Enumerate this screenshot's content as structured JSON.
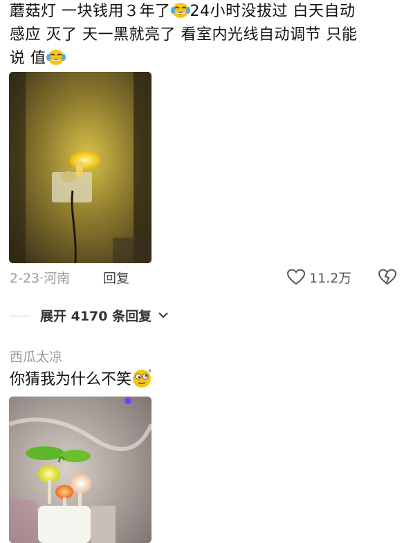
{
  "comment1": {
    "text_line1_a": "蘑菇灯 一块钱用３年了",
    "text_line1_b": "24小时没拔过 白天自动",
    "text_line2": "感应 灭了 天一黑就亮了 看室内光线自动调节 只能",
    "text_line3": "说 值",
    "emoji1": "laughing-tears-emoji",
    "emoji2": "laughing-tears-emoji",
    "image": "mushroom-night-light-photo",
    "date": "2-23",
    "separator": "·",
    "location": "河南",
    "reply_label": "回复",
    "like_count": "11.2万"
  },
  "expand": {
    "label": "展开 4170 条回复"
  },
  "comment2": {
    "username": "西瓜太凉",
    "text": "你猜我为什么不笑",
    "emoji": "dizzy-face-emoji",
    "image": "colorful-mushroom-lights-photo"
  },
  "colors": {
    "text": "#111111",
    "meta": "#9a9a9a"
  }
}
